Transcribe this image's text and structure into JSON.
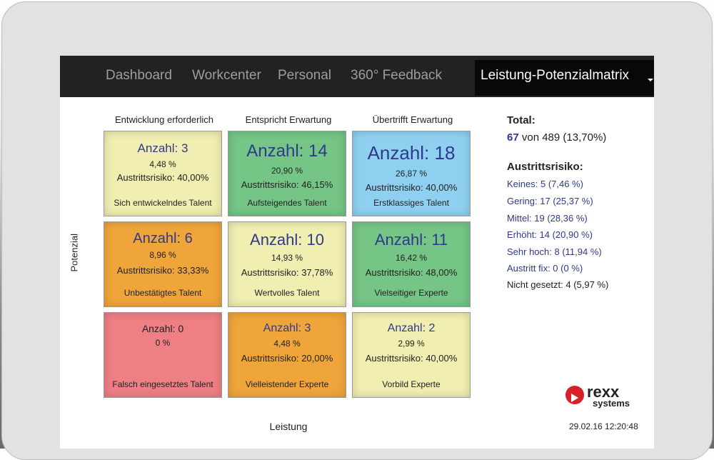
{
  "nav": {
    "items": [
      "Dashboard",
      "Workcenter",
      "Personal",
      "360° Feedback"
    ],
    "active": "Leistung-Potenzialmatrix"
  },
  "matrix": {
    "columns": [
      "Entwicklung erforderlich",
      "Entspricht Erwartung",
      "Übertrifft Erwartung"
    ],
    "y_label": "Potenzial",
    "x_label": "Leistung",
    "cells": [
      {
        "count": "Anzahl: 3",
        "pct": "4,48 %",
        "risk": "Austrittsrisiko: 40,00%",
        "talent": "Sich entwickelndes Talent",
        "color": "#f0eeb0"
      },
      {
        "count": "Anzahl: 14",
        "pct": "20,90 %",
        "risk": "Austrittsrisiko: 46,15%",
        "talent": "Aufsteigendes Talent",
        "color": "#74c586"
      },
      {
        "count": "Anzahl: 18",
        "pct": "26,87 %",
        "risk": "Austrittsrisiko: 40,00%",
        "talent": "Erstklassiges Talent",
        "color": "#8fd0f0"
      },
      {
        "count": "Anzahl: 6",
        "pct": "8,96 %",
        "risk": "Austrittsrisiko: 33,33%",
        "talent": "Unbestätigtes Talent",
        "color": "#f0a53a"
      },
      {
        "count": "Anzahl: 10",
        "pct": "14,93 %",
        "risk": "Austrittsrisiko: 37,78%",
        "talent": "Wertvolles Talent",
        "color": "#f0eeb0"
      },
      {
        "count": "Anzahl: 11",
        "pct": "16,42 %",
        "risk": "Austrittsrisiko: 48,00%",
        "talent": "Vielseitiger Experte",
        "color": "#74c586"
      },
      {
        "count": "Anzahl: 0",
        "pct": "0 %",
        "risk": "",
        "talent": "Falsch eingesetztes Talent",
        "color": "#ee7f84"
      },
      {
        "count": "Anzahl: 3",
        "pct": "4,48 %",
        "risk": "Austrittsrisiko: 20,00%",
        "talent": "Vielleistender Experte",
        "color": "#f0a53a"
      },
      {
        "count": "Anzahl: 2",
        "pct": "2,99 %",
        "risk": "Austrittsrisiko: 40,00%",
        "talent": "Vorbild Experte",
        "color": "#f0eeb0"
      }
    ]
  },
  "summary": {
    "total_label": "Total:",
    "total_count": "67",
    "total_rest": "von 489 (13,70%)",
    "risk_title": "Austrittsrisiko:",
    "risk_items": [
      "Keines: 5 (7,46 %)",
      "Gering: 17 (25,37 %)",
      "Mittel: 19 (28,36 %)",
      "Erhöht: 14 (20,90 %)",
      "Sehr hoch: 8 (11,94 %)",
      "Austritt fix: 0 (0 %)",
      "Nicht gesetzt: 4 (5,97 %)"
    ]
  },
  "logo": {
    "brand": "rexx",
    "sub": "systems"
  },
  "timestamp": "29.02.16 12:20:48"
}
